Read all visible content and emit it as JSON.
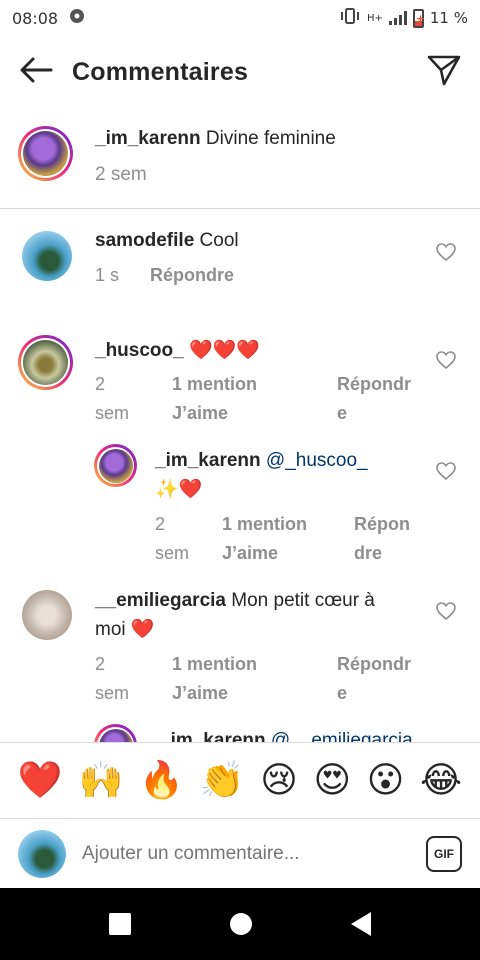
{
  "status_bar": {
    "time": "08:08",
    "network": "H+",
    "battery": "11 %"
  },
  "header": {
    "title": "Commentaires"
  },
  "caption": {
    "username": "_im_karenn",
    "text": "Divine feminine",
    "time": "2 sem"
  },
  "comments": [
    {
      "username": "samodefile",
      "text": "Cool",
      "time": "1 s",
      "reply": "Répondre"
    },
    {
      "username": "_huscoo_",
      "text": "❤️❤️❤️",
      "time_line1": "2",
      "time_line2": "sem",
      "likes_line1": "1 mention",
      "likes_line2": "J’aime",
      "reply_line1": "Répondr",
      "reply_line2": "e"
    },
    {
      "username": "_im_karenn",
      "mention": "@_huscoo_",
      "text": "✨❤️",
      "time_line1": "2",
      "time_line2": "sem",
      "likes_line1": "1 mention",
      "likes_line2": "J’aime",
      "reply_line1": "Répon",
      "reply_line2": "dre"
    },
    {
      "username": "__emiliegarcia",
      "text_line1": "Mon petit cœur à",
      "text_line2": "moi ❤️",
      "time_line1": "2",
      "time_line2": "sem",
      "likes_line1": "1 mention",
      "likes_line2": "J’aime",
      "reply_line1": "Répondr",
      "reply_line2": "e"
    },
    {
      "username": "_im_karenn",
      "mention": "@__emiliegarcia"
    }
  ],
  "reactions": [
    "❤️",
    "🙌",
    "🔥",
    "👏",
    "😢",
    "😍",
    "😮",
    "😂"
  ],
  "composer": {
    "placeholder": "Ajouter un commentaire...",
    "gif_label": "GIF"
  },
  "icons": {
    "back": "arrow-left-icon",
    "share": "paper-plane-icon",
    "like": "heart-outline-icon"
  },
  "colors": {
    "mention": "#00376b",
    "secondary_text": "#8e8e8e",
    "accent_red": "#ed4956"
  }
}
